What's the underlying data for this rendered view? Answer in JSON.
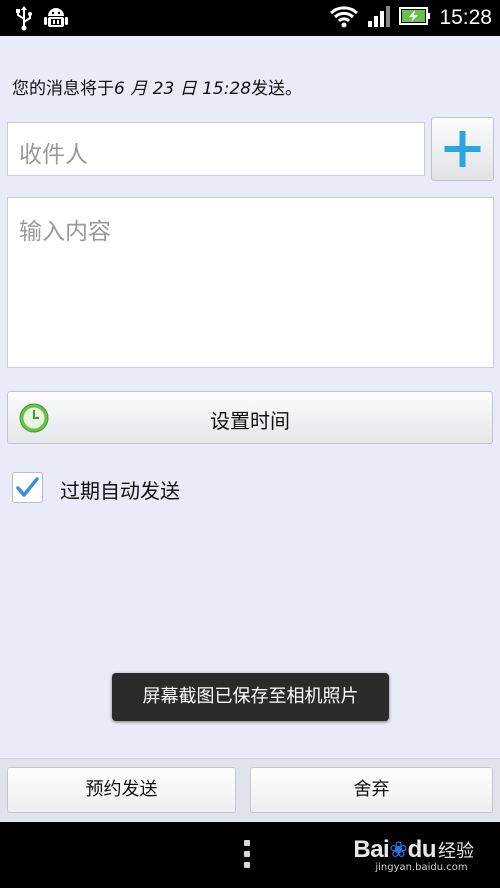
{
  "status_bar": {
    "time": "15:28",
    "icons": [
      "usb-icon",
      "android-debug-icon",
      "wifi-icon",
      "signal-icon",
      "battery-charging-icon"
    ]
  },
  "schedule_notice": {
    "prefix": "您的消息将于",
    "date": "6 月 23 日 15:28",
    "suffix": "发送。"
  },
  "recipient": {
    "placeholder": "收件人"
  },
  "message": {
    "placeholder": "输入内容"
  },
  "set_time": {
    "label": "设置时间"
  },
  "auto_send": {
    "label": "过期自动发送",
    "checked": true
  },
  "toast": {
    "text": "屏幕截图已保存至相机照片"
  },
  "actions": {
    "schedule_send": "预约发送",
    "discard": "舍弃"
  },
  "watermark": {
    "logo": "Bai",
    "logo_end": "du",
    "jingyan": "经验",
    "url": "jingyan.baidu.com"
  },
  "colors": {
    "accent_plus": "#2aa6e0",
    "clock_green": "#6cc04a",
    "check_blue": "#3a8fd8"
  }
}
